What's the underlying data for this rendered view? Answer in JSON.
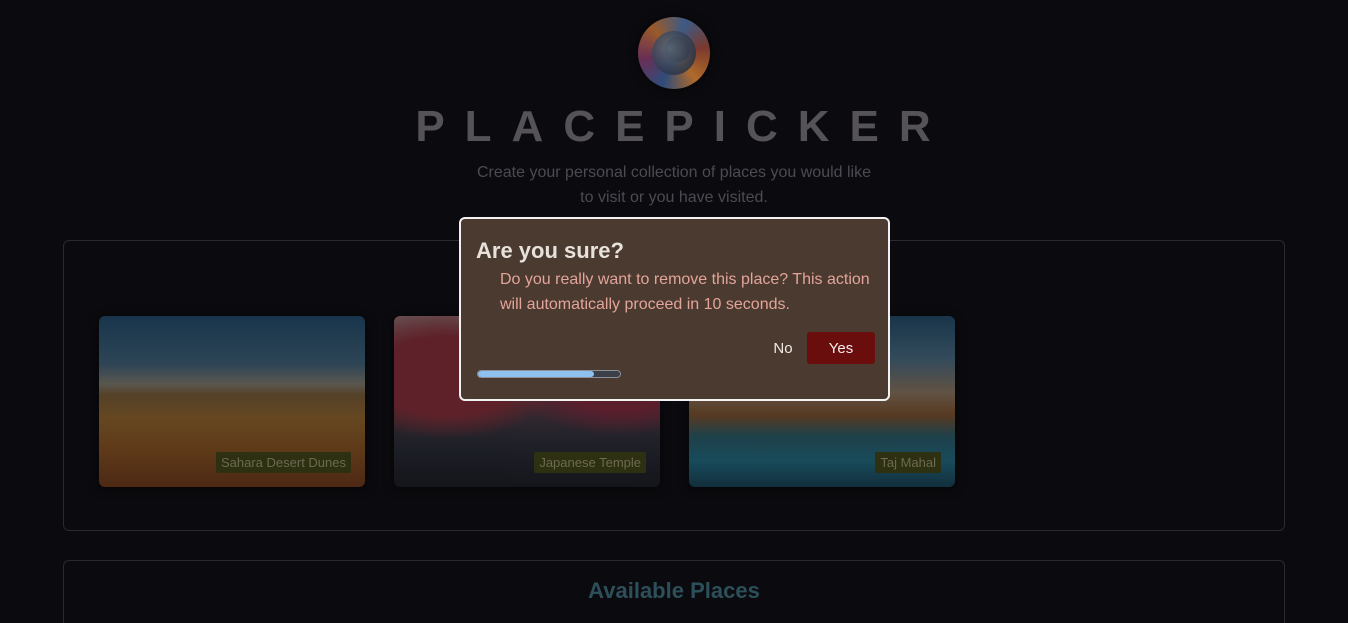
{
  "header": {
    "title": "PLACEPICKER",
    "subtitle": "Create your personal collection of places you would like to visit or you have visited.",
    "logo_icon": "globe-icon"
  },
  "picked_places": [
    {
      "title": "Sahara Desert Dunes"
    },
    {
      "title": "Japanese Temple"
    },
    {
      "title": "Taj Mahal"
    }
  ],
  "available": {
    "title": "Available Places"
  },
  "dialog": {
    "title": "Are you sure?",
    "text": "Do you really want to remove this place? This action will automatically proceed in 10 seconds.",
    "no_label": "No",
    "yes_label": "Yes",
    "progress_fraction": 0.82
  },
  "colors": {
    "background": "#0b0b0f",
    "dialog_bg": "#4a3a2f",
    "dialog_text": "#e3a49a",
    "yes_button": "#6a0d0d",
    "progress_fill": "#8ec1f0",
    "available_title": "#2c4f5a"
  }
}
